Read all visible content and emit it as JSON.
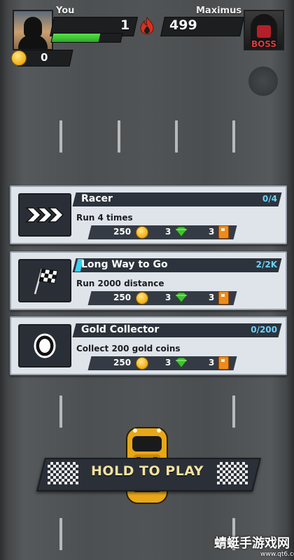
{
  "hud": {
    "player_name": "You",
    "player_score": "1",
    "player_progress": 0.68,
    "opponent_name": "Maximus",
    "opponent_score": "499",
    "boss_label": "BOSS",
    "coins": "0"
  },
  "missions": [
    {
      "title": "Racer",
      "progress": "0/4",
      "description": "Run 4 times",
      "icon": "chevrons-icon",
      "highlighted": false,
      "rewards": {
        "coins": "250",
        "gems": "3",
        "fuel": "3"
      }
    },
    {
      "title": "Long Way to Go",
      "progress": "2/2K",
      "description": "Run 2000 distance",
      "icon": "checkered-flag-icon",
      "highlighted": true,
      "rewards": {
        "coins": "250",
        "gems": "3",
        "fuel": "3"
      }
    },
    {
      "title": "Gold Collector",
      "progress": "0/200",
      "description": "Collect 200 gold coins",
      "icon": "gold-coin-icon",
      "highlighted": false,
      "rewards": {
        "coins": "250",
        "gems": "3",
        "fuel": "3"
      }
    }
  ],
  "play_button": {
    "label": "HOLD TO PLAY"
  },
  "watermark": {
    "text": "蜻蜓手游戏网",
    "url": "www.qt6.com"
  },
  "colors": {
    "accent_green": "#3fc132",
    "progress_blue": "#6cd2ff",
    "play_text": "#f2e3a0",
    "boss_red": "#e23b3b"
  }
}
